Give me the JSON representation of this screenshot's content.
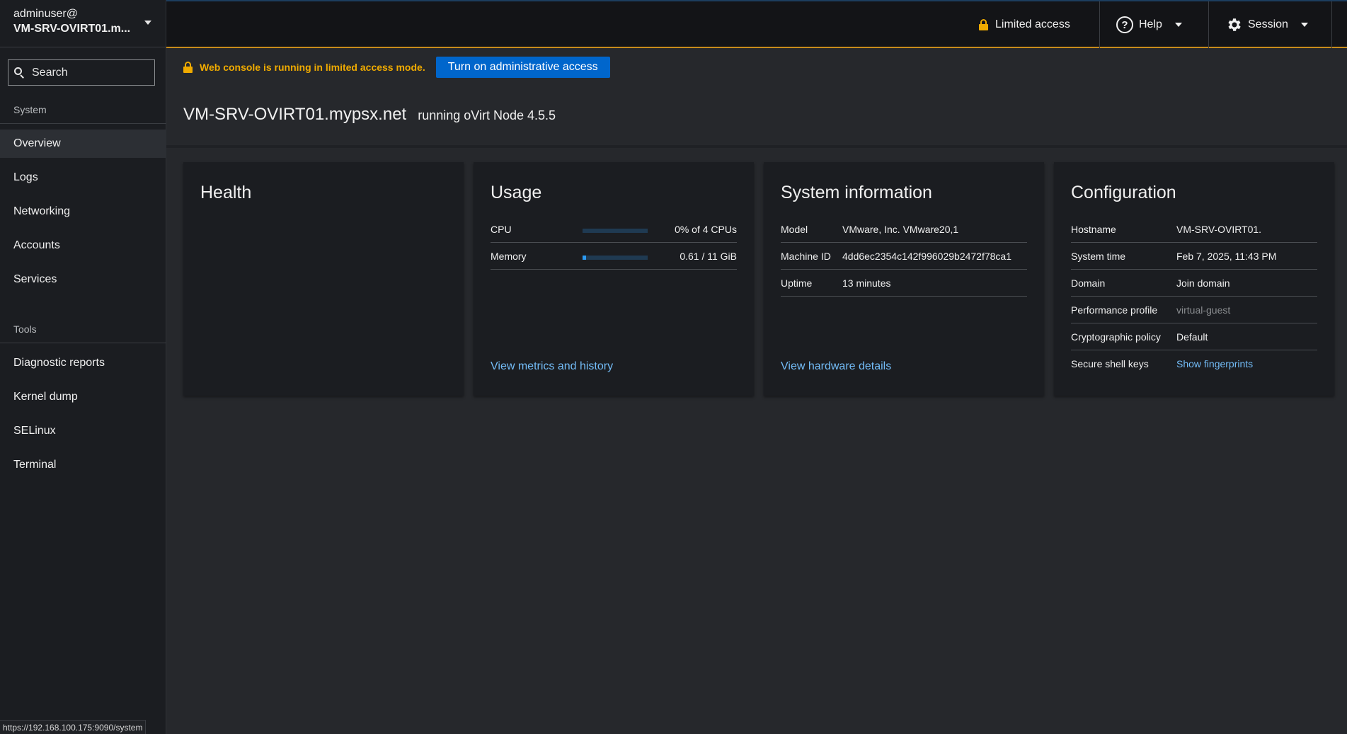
{
  "sidebar": {
    "host_user": "adminuser@",
    "host_name": "VM-SRV-OVIRT01.m...",
    "search_placeholder": "Search",
    "sections": [
      {
        "title": "System",
        "items": [
          {
            "label": "Overview",
            "active": true
          },
          {
            "label": "Logs"
          },
          {
            "label": "Networking"
          },
          {
            "label": "Accounts"
          },
          {
            "label": "Services"
          }
        ]
      },
      {
        "title": "Tools",
        "items": [
          {
            "label": "Diagnostic reports"
          },
          {
            "label": "Kernel dump"
          },
          {
            "label": "SELinux"
          },
          {
            "label": "Terminal"
          }
        ]
      }
    ],
    "status_url": "https://192.168.100.175:9090/system"
  },
  "topbar": {
    "limited_access": "Limited access",
    "help": "Help",
    "session": "Session"
  },
  "alert": {
    "text": "Web console is running in limited access mode.",
    "button": "Turn on administrative access"
  },
  "header": {
    "title": "VM-SRV-OVIRT01.mypsx.net",
    "subtitle": "running oVirt Node 4.5.5"
  },
  "cards": {
    "health": {
      "title": "Health"
    },
    "usage": {
      "title": "Usage",
      "rows": [
        {
          "label": "CPU",
          "value": "0% of 4 CPUs",
          "fill": 0
        },
        {
          "label": "Memory",
          "value": "0.61 / 11 GiB",
          "fill": 0.055
        }
      ],
      "link": "View metrics and history"
    },
    "system_info": {
      "title": "System information",
      "rows": [
        {
          "label": "Model",
          "value": "VMware, Inc. VMware20,1"
        },
        {
          "label": "Machine ID",
          "value": "4dd6ec2354c142f996029b2472f78ca1"
        },
        {
          "label": "Uptime",
          "value": "13 minutes"
        }
      ],
      "link": "View hardware details"
    },
    "configuration": {
      "title": "Configuration",
      "rows": [
        {
          "label": "Hostname",
          "value": "VM-SRV-OVIRT01."
        },
        {
          "label": "System time",
          "value": "Feb 7, 2025, 11:43 PM"
        },
        {
          "label": "Domain",
          "value": "Join domain"
        },
        {
          "label": "Performance profile",
          "value": "virtual-guest"
        },
        {
          "label": "Cryptographic policy",
          "value": "Default"
        },
        {
          "label": "Secure shell keys",
          "value": "Show fingerprints"
        }
      ]
    }
  },
  "colors": {
    "accent": "#0066cc",
    "warning": "#f0ab00",
    "link": "#73bcf7",
    "background": "#26282c",
    "sidebar": "#1b1d21"
  }
}
